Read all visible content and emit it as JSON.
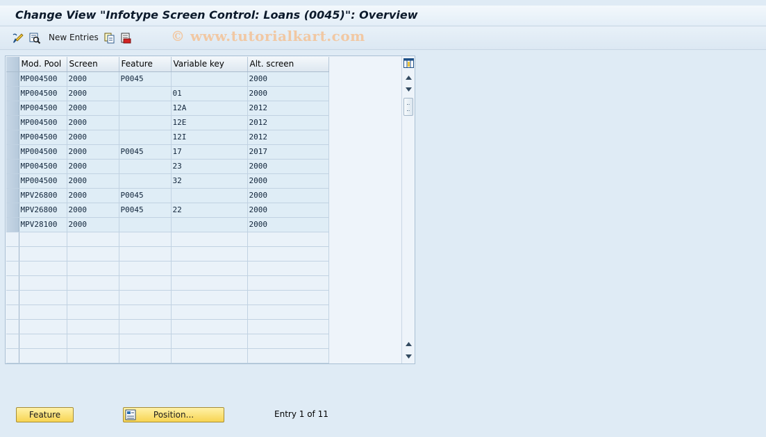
{
  "window": {
    "title": "Change View \"Infotype Screen Control: Loans (0045)\": Overview"
  },
  "toolbar": {
    "new_entries_label": "New Entries"
  },
  "watermark": "© www.tutorialkart.com",
  "table": {
    "columns": [
      "Mod. Pool",
      "Screen",
      "Feature",
      "Variable key",
      "Alt. screen"
    ],
    "rows": [
      [
        "MP004500",
        "2000",
        "P0045",
        "",
        "2000"
      ],
      [
        "MP004500",
        "2000",
        "",
        "01",
        "2000"
      ],
      [
        "MP004500",
        "2000",
        "",
        "12A",
        "2012"
      ],
      [
        "MP004500",
        "2000",
        "",
        "12E",
        "2012"
      ],
      [
        "MP004500",
        "2000",
        "",
        "12I",
        "2012"
      ],
      [
        "MP004500",
        "2000",
        "P0045",
        "17",
        "2017"
      ],
      [
        "MP004500",
        "2000",
        "",
        "23",
        "2000"
      ],
      [
        "MP004500",
        "2000",
        "",
        "32",
        "2000"
      ],
      [
        "MPV26800",
        "2000",
        "P0045",
        "",
        "2000"
      ],
      [
        "MPV26800",
        "2000",
        "P0045",
        "22",
        "2000"
      ],
      [
        "MPV28100",
        "2000",
        "",
        "",
        "2000"
      ]
    ],
    "empty_rows": 9
  },
  "footer": {
    "feature_button": "Feature",
    "position_button": "Position...",
    "entry_info": "Entry 1 of 11"
  },
  "colors": {
    "button_fill": "#f7d452",
    "title_text": "#0c1a2b",
    "watermark": "#f1c8a3"
  },
  "icons": [
    "display-change-icon",
    "details-icon",
    "copy-icon",
    "delete-icon",
    "column-settings-icon",
    "scroll-up-icon",
    "scroll-down-icon",
    "position-icon"
  ]
}
